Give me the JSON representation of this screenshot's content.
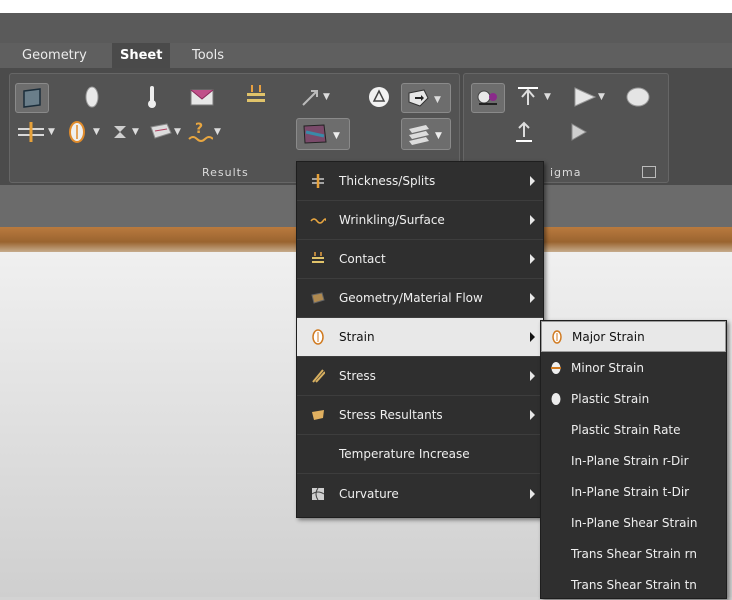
{
  "tabs": [
    {
      "label": "Geometry"
    },
    {
      "label": "Sheet"
    },
    {
      "label": "Tools"
    }
  ],
  "ribbon": {
    "results_group_label": "Results",
    "sigma_group_label": "igma"
  },
  "menu": {
    "items": [
      {
        "label": "Thickness/Splits",
        "icon": "thickness-icon",
        "submenu": true
      },
      {
        "label": "Wrinkling/Surface",
        "icon": "wrinkling-icon",
        "submenu": true
      },
      {
        "label": "Contact",
        "icon": "contact-icon",
        "submenu": true
      },
      {
        "label": "Geometry/Material Flow",
        "icon": "material-flow-icon",
        "submenu": true
      },
      {
        "label": "Strain",
        "icon": "strain-icon",
        "submenu": true
      },
      {
        "label": "Stress",
        "icon": "stress-icon",
        "submenu": true
      },
      {
        "label": "Stress Resultants",
        "icon": "stress-resultants-icon",
        "submenu": true
      },
      {
        "label": "Temperature Increase",
        "icon": "",
        "submenu": false
      },
      {
        "label": "Curvature",
        "icon": "curvature-icon",
        "submenu": true
      }
    ],
    "highlighted": "Strain"
  },
  "submenu": {
    "items": [
      {
        "label": "Major Strain",
        "icon": "major-strain-icon"
      },
      {
        "label": "Minor Strain",
        "icon": "minor-strain-icon"
      },
      {
        "label": "Plastic Strain",
        "icon": "plastic-strain-icon"
      },
      {
        "label": "Plastic Strain Rate",
        "icon": ""
      },
      {
        "label": "In-Plane Strain r-Dir",
        "icon": ""
      },
      {
        "label": "In-Plane Strain t-Dir",
        "icon": ""
      },
      {
        "label": "In-Plane Shear Strain",
        "icon": ""
      },
      {
        "label": "Trans Shear Strain rn",
        "icon": ""
      },
      {
        "label": "Trans Shear Strain tn",
        "icon": ""
      }
    ],
    "highlighted": "Major Strain"
  },
  "colors": {
    "ribbon_bg": "#4b4b4b",
    "menu_bg": "#2f2f2f",
    "highlight_bg": "#e8e8e8",
    "accent_orange": "#b97a3e"
  }
}
